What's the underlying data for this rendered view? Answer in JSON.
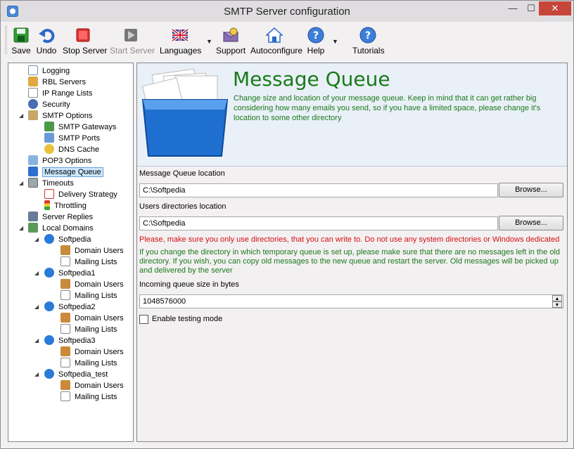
{
  "window": {
    "title": "SMTP Server configuration",
    "controls": {
      "minimize": "—",
      "maximize": "☐",
      "close": "✕"
    }
  },
  "toolbar": {
    "save": "Save",
    "undo": "Undo",
    "stop_server": "Stop Server",
    "start_server": "Start Server",
    "languages": "Languages",
    "support": "Support",
    "autoconfigure": "Autoconfigure",
    "help": "Help",
    "tutorials": "Tutorials",
    "dropdown_arrow": "▼"
  },
  "tree": {
    "items": [
      {
        "label": "Logging",
        "icon": "logging-icon"
      },
      {
        "label": "RBL Servers",
        "icon": "rbl-icon"
      },
      {
        "label": "IP Range Lists",
        "icon": "ip-range-icon"
      },
      {
        "label": "Security",
        "icon": "security-icon"
      },
      {
        "label": "SMTP Options",
        "icon": "smtp-options-icon"
      },
      {
        "label": "SMTP Gateways",
        "icon": "gateway-icon"
      },
      {
        "label": "SMTP Ports",
        "icon": "ports-icon"
      },
      {
        "label": "DNS Cache",
        "icon": "dns-icon"
      },
      {
        "label": "POP3 Options",
        "icon": "pop3-icon"
      },
      {
        "label": "Message Queue",
        "icon": "queue-icon"
      },
      {
        "label": "Timeouts",
        "icon": "timeouts-icon"
      },
      {
        "label": "Delivery Strategy",
        "icon": "calendar-icon"
      },
      {
        "label": "Throttling",
        "icon": "traffic-light-icon"
      },
      {
        "label": "Server Replies",
        "icon": "server-icon"
      },
      {
        "label": "Local Domains",
        "icon": "domains-icon"
      },
      {
        "label": "Softpedia",
        "icon": "globe-icon"
      },
      {
        "label": "Domain Users",
        "icon": "users-icon"
      },
      {
        "label": "Mailing Lists",
        "icon": "list-icon"
      },
      {
        "label": "Softpedia1",
        "icon": "globe-icon"
      },
      {
        "label": "Domain Users",
        "icon": "users-icon"
      },
      {
        "label": "Mailing Lists",
        "icon": "list-icon"
      },
      {
        "label": "Softpedia2",
        "icon": "globe-icon"
      },
      {
        "label": "Domain Users",
        "icon": "users-icon"
      },
      {
        "label": "Mailing Lists",
        "icon": "list-icon"
      },
      {
        "label": "Softpedia3",
        "icon": "globe-icon"
      },
      {
        "label": "Domain Users",
        "icon": "users-icon"
      },
      {
        "label": "Mailing Lists",
        "icon": "list-icon"
      },
      {
        "label": "Softpedia_test",
        "icon": "globe-icon"
      },
      {
        "label": "Domain Users",
        "icon": "users-icon"
      },
      {
        "label": "Mailing Lists",
        "icon": "list-icon"
      }
    ]
  },
  "main": {
    "title": "Message Queue",
    "description": "Change size and location of your message queue. Keep in mind that it can get rather big considering how many emails you send, so if you have a limited space, please change it's location to some other directory",
    "queue_location_label": "Message Queue location",
    "queue_location_value": "C:\\Softpedia",
    "users_dir_label": "Users directories location",
    "users_dir_value": "C:\\Softpedia",
    "browse": "Browse...",
    "warning_red": "Please, make sure you only use directories, that you can write to. Do not use any system directories or Windows dedicated",
    "warning_green": "If you change the directory in which temporary queue is set up, please make sure that there are no messages left in the old directory. If you wish, you can copy old messages to the new queue and restart the server. Old messages will be picked up and delivered by the server",
    "queue_size_label": "Incoming queue size in bytes",
    "queue_size_value": "1048576000",
    "spin_up": "▲",
    "spin_down": "▼",
    "testing_mode_label": "Enable testing mode",
    "testing_mode_checked": false
  },
  "colors": {
    "title_green": "#1a7a1a",
    "warning_red": "#d51010",
    "selection_blue": "#cce8ff"
  }
}
